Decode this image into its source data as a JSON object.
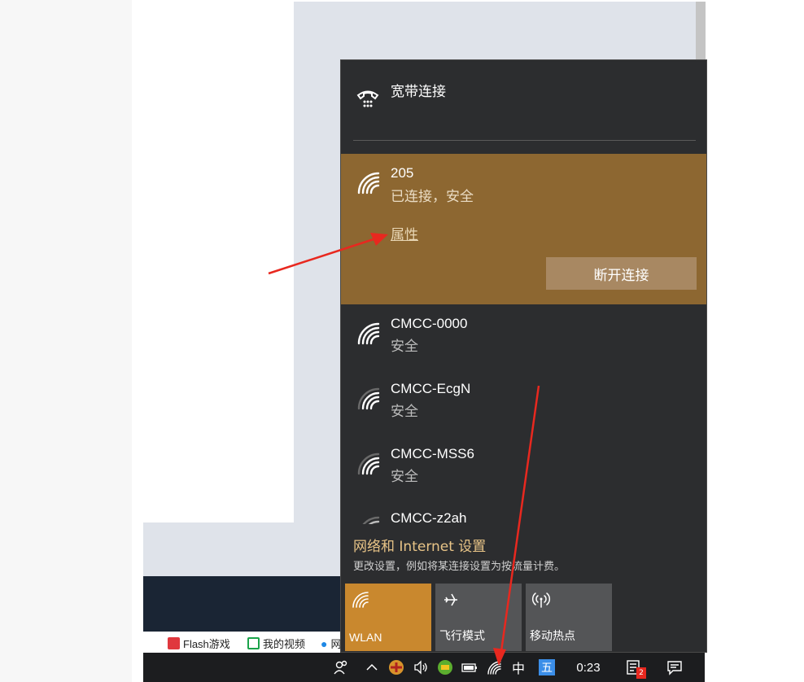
{
  "bookmarks": [
    {
      "label": "Flash游戏",
      "icon": "flash-game-icon",
      "color": "#e0383e"
    },
    {
      "label": "我的视频",
      "icon": "video-icon",
      "color": "#1aa34a"
    },
    {
      "label": "网",
      "icon": "drop-icon",
      "color": "#1e88e5"
    }
  ],
  "flyout": {
    "broadband": {
      "label": "宽带连接",
      "icon": "dial-up-phone-icon"
    },
    "connected_network": {
      "name": "205",
      "status": "已连接，安全",
      "properties_link": "属性",
      "disconnect_button": "断开连接",
      "icon": "wifi-icon"
    },
    "networks": [
      {
        "name": "CMCC-0000",
        "status": "安全",
        "icon": "wifi-icon"
      },
      {
        "name": "CMCC-EcgN",
        "status": "安全",
        "icon": "wifi-icon"
      },
      {
        "name": "CMCC-MSS6",
        "status": "安全",
        "icon": "wifi-icon"
      },
      {
        "name": "CMCC-z2ah",
        "status": "",
        "icon": "wifi-icon"
      }
    ],
    "settings": {
      "title": "网络和 Internet 设置",
      "description": "更改设置，例如将某连接设置为按流量计费。"
    },
    "quick_actions": [
      {
        "label": "WLAN",
        "icon": "wifi-icon",
        "active": true
      },
      {
        "label": "飞行模式",
        "icon": "airplane-icon",
        "active": false
      },
      {
        "label": "移动热点",
        "icon": "hotspot-icon",
        "active": false
      }
    ]
  },
  "taskbar": {
    "ime_label": "中",
    "wubi_label": "五",
    "time": "0:23",
    "notification_badge": "2"
  },
  "colors": {
    "accent": "#8d6731",
    "accent_tile": "#c9882e",
    "flyout_bg": "#2c2d2f",
    "link": "#e8c487",
    "arrow": "#e8281f"
  }
}
